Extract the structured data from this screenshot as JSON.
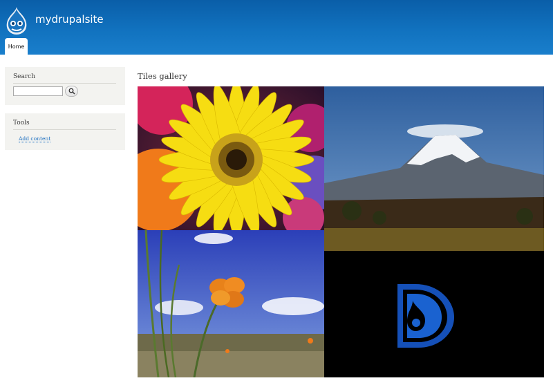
{
  "site": {
    "name": "mydrupalsite"
  },
  "nav": {
    "tabs": [
      {
        "label": "Home"
      }
    ]
  },
  "sidebar": {
    "search": {
      "title": "Search",
      "input_value": ""
    },
    "tools": {
      "title": "Tools",
      "links": [
        {
          "label": "Add content"
        }
      ]
    }
  },
  "main": {
    "title": "Tiles gallery",
    "images": [
      {
        "icon": "yellow-gerbera-flower"
      },
      {
        "icon": "snow-capped-volcano"
      },
      {
        "icon": "orange-poppy-flower"
      },
      {
        "icon": "drupal-drop-logo"
      }
    ]
  },
  "colors": {
    "header_top": "#0a5ea8",
    "header_bottom": "#1a7fcc",
    "link": "#1a6ec0",
    "sidebar_bg": "#f3f3f0"
  }
}
